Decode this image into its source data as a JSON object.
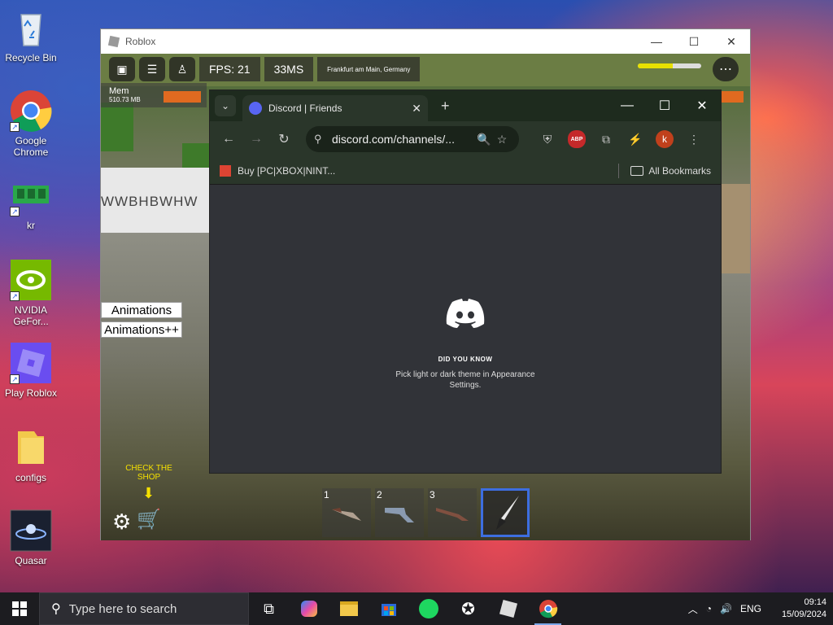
{
  "desktop": {
    "icons": [
      {
        "label": "Recycle Bin",
        "icon": "recycle-bin-icon"
      },
      {
        "label": "Google Chrome",
        "icon": "chrome-icon"
      },
      {
        "label": "kr",
        "icon": "memory-chip-icon"
      },
      {
        "label": "NVIDIA GeFor...",
        "icon": "nvidia-icon"
      },
      {
        "label": "Play Roblox",
        "icon": "roblox-icon"
      },
      {
        "label": "configs",
        "icon": "folder-icon"
      },
      {
        "label": "Quasar",
        "icon": "quasar-icon"
      }
    ]
  },
  "roblox": {
    "window_title": "Roblox",
    "fps": "FPS: 21",
    "ping": "33MS",
    "region": "Frankfurt am Main, Germany",
    "mem_label": "Mem",
    "mem_value": "510.73 MB",
    "wall_text": "WWBHBWHW",
    "anim_button_1": "Animations",
    "anim_button_2": "Animations++",
    "shop_hint": "CHECK THE SHOP",
    "health_fraction": 0.55,
    "hotbar": [
      {
        "num": "1",
        "item": "knife-icon"
      },
      {
        "num": "2",
        "item": "revolver-icon"
      },
      {
        "num": "3",
        "item": "shotgun-icon"
      },
      {
        "num": "",
        "item": "dagger-icon",
        "selected": true
      }
    ]
  },
  "chrome": {
    "tab_title": "Discord | Friends",
    "url": "discord.com/channels/...",
    "bookmark_1": "Buy [PC|XBOX|NINT...",
    "all_bookmarks": "All Bookmarks",
    "profile_initial": "k"
  },
  "discord": {
    "did_you_know": "DID YOU KNOW",
    "tip": "Pick light or dark theme in Appearance Settings."
  },
  "taskbar": {
    "search_placeholder": "Type here to search",
    "language": "ENG",
    "time": "09:14",
    "date": "15/09/2024"
  }
}
